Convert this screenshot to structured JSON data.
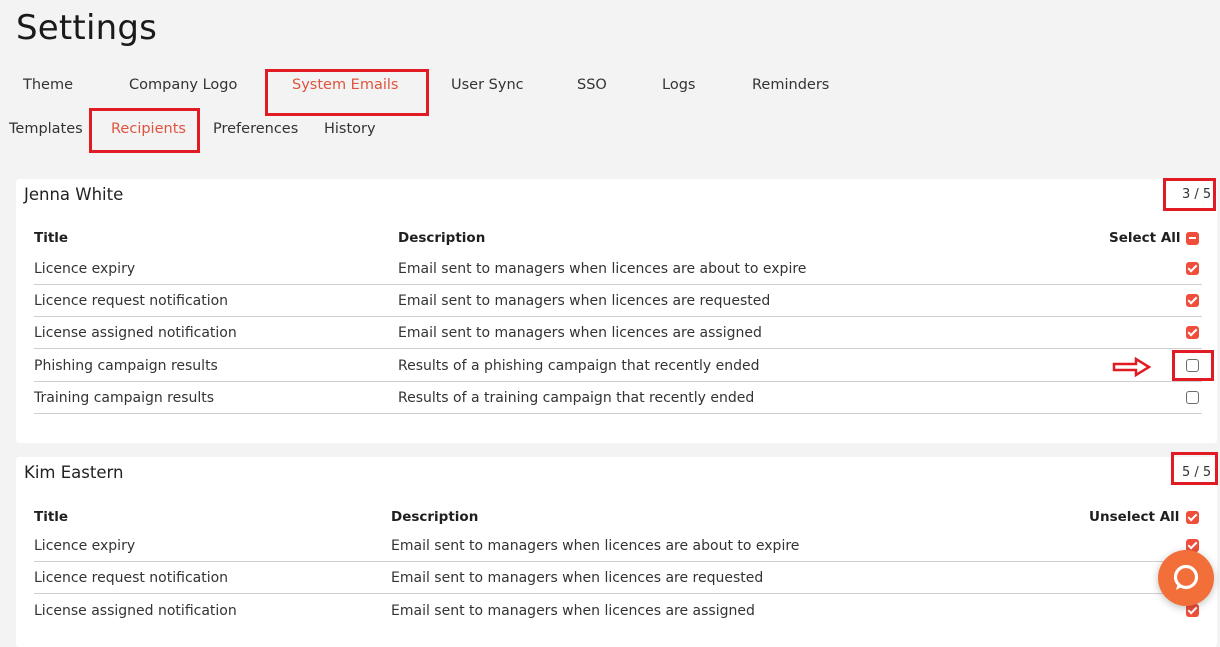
{
  "page": {
    "title": "Settings"
  },
  "tabs": [
    {
      "label": "Theme",
      "active": false
    },
    {
      "label": "Company Logo",
      "active": false
    },
    {
      "label": "System Emails",
      "active": true
    },
    {
      "label": "User Sync",
      "active": false
    },
    {
      "label": "SSO",
      "active": false
    },
    {
      "label": "Logs",
      "active": false
    },
    {
      "label": "Reminders",
      "active": false
    }
  ],
  "subtabs": [
    {
      "label": "Templates",
      "active": false
    },
    {
      "label": "Recipients",
      "active": true
    },
    {
      "label": "Preferences",
      "active": false
    },
    {
      "label": "History",
      "active": false
    }
  ],
  "cards": [
    {
      "name": "Jenna White",
      "count": "3 / 5",
      "headers": {
        "title": "Title",
        "description": "Description",
        "select": "Select All"
      },
      "select_state": "partial",
      "rows": [
        {
          "title": "Licence expiry",
          "description": "Email sent to managers when licences are about to expire",
          "checked": true
        },
        {
          "title": "Licence request notification",
          "description": "Email sent to managers when licences are requested",
          "checked": true
        },
        {
          "title": "License assigned notification",
          "description": "Email sent to managers when licences are assigned",
          "checked": true
        },
        {
          "title": "Phishing campaign results",
          "description": "Results of a phishing campaign that recently ended",
          "checked": false
        },
        {
          "title": "Training campaign results",
          "description": "Results of a training campaign that recently ended",
          "checked": false
        }
      ]
    },
    {
      "name": "Kim Eastern",
      "count": "5 / 5",
      "headers": {
        "title": "Title",
        "description": "Description",
        "select": "Unselect All"
      },
      "select_state": "all",
      "rows": [
        {
          "title": "Licence expiry",
          "description": "Email sent to managers when licences are about to expire",
          "checked": true
        },
        {
          "title": "Licence request notification",
          "description": "Email sent to managers when licences are requested",
          "checked": true
        },
        {
          "title": "License assigned notification",
          "description": "Email sent to managers when licences are assigned",
          "checked": true
        }
      ]
    }
  ],
  "colors": {
    "accent": "#e0543e",
    "checkbox": "#ef4f3a",
    "highlight": "#e01b24",
    "help": "#f26f3a"
  },
  "icons": {
    "arrow": "arrow-right-icon",
    "help": "chat-help-icon"
  }
}
